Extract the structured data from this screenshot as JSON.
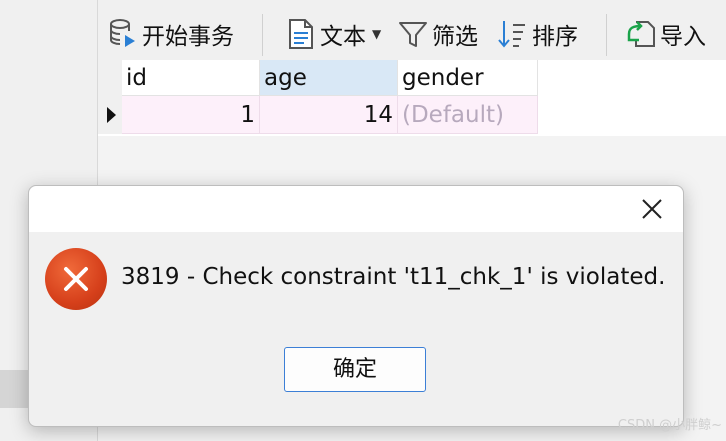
{
  "toolbar": {
    "begin_transaction": "开始事务",
    "text": "文本",
    "filter": "筛选",
    "sort": "排序",
    "import": "导入",
    "icons": [
      "database-transaction-icon",
      "text-document-icon",
      "funnel-filter-icon",
      "sort-icon",
      "import-icon"
    ]
  },
  "grid": {
    "columns": [
      "id",
      "age",
      "gender"
    ],
    "row": {
      "id": "1",
      "age": "14",
      "gender": "(Default)"
    }
  },
  "dialog": {
    "message": "3819 - Check constraint 't11_chk_1' is violated.",
    "ok_label": "确定",
    "icon": "error-icon",
    "accent": "#d6401b"
  },
  "watermark": "CSDN @小胖鲸~"
}
